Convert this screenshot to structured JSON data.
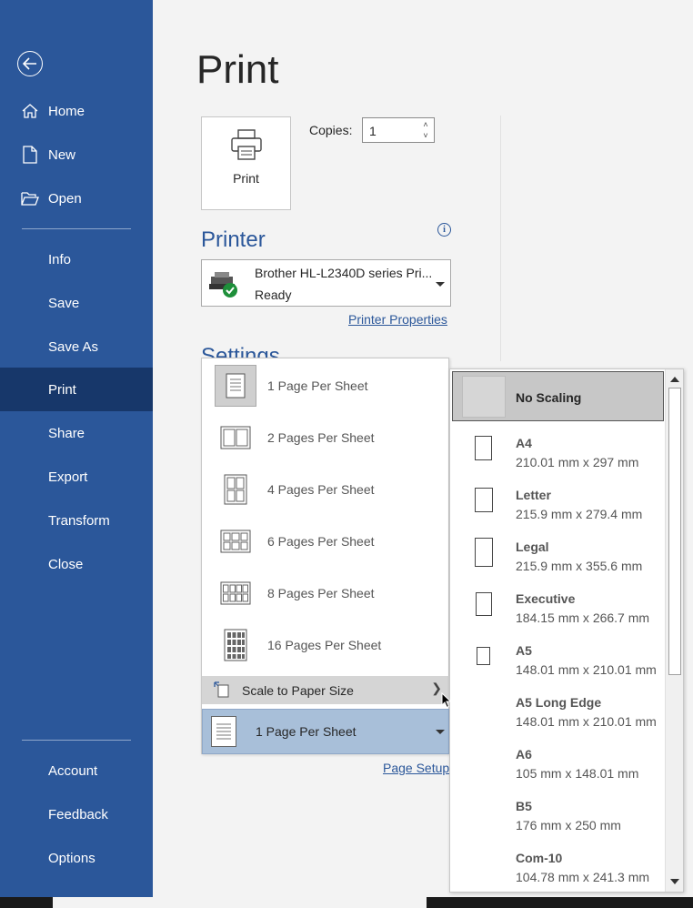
{
  "sidebar": {
    "items": [
      {
        "label": "Home",
        "icon": "home-icon"
      },
      {
        "label": "New",
        "icon": "new-document-icon"
      },
      {
        "label": "Open",
        "icon": "folder-open-icon"
      },
      {
        "label": "Info"
      },
      {
        "label": "Save"
      },
      {
        "label": "Save As"
      },
      {
        "label": "Print"
      },
      {
        "label": "Share"
      },
      {
        "label": "Export"
      },
      {
        "label": "Transform"
      },
      {
        "label": "Close"
      },
      {
        "label": "Account"
      },
      {
        "label": "Feedback"
      },
      {
        "label": "Options"
      }
    ],
    "active": "Print"
  },
  "main": {
    "title": "Print",
    "print_button_label": "Print",
    "copies_label": "Copies:",
    "copies_value": "1",
    "printer_heading": "Printer",
    "printer_name": "Brother HL-L2340D series Pri...",
    "printer_status": "Ready",
    "printer_properties_link": "Printer Properties",
    "settings_heading": "Settings",
    "page_setup_link": "Page Setup"
  },
  "pages_per_sheet_menu": {
    "items": [
      {
        "label": "1 Page Per Sheet",
        "selected": true
      },
      {
        "label": "2 Pages Per Sheet"
      },
      {
        "label": "4 Pages Per Sheet"
      },
      {
        "label": "6 Pages Per Sheet"
      },
      {
        "label": "8 Pages Per Sheet"
      },
      {
        "label": "16 Pages Per Sheet"
      }
    ],
    "scale_label": "Scale to Paper Size",
    "current_value": "1 Page Per Sheet"
  },
  "paper_size_menu": {
    "no_scaling_label": "No Scaling",
    "items": [
      {
        "name": "A4",
        "dim": "210.01 mm x 297 mm"
      },
      {
        "name": "Letter",
        "dim": "215.9 mm x 279.4 mm"
      },
      {
        "name": "Legal",
        "dim": "215.9 mm x 355.6 mm"
      },
      {
        "name": "Executive",
        "dim": "184.15 mm x 266.7 mm"
      },
      {
        "name": "A5",
        "dim": "148.01 mm x 210.01 mm"
      },
      {
        "name": "A5 Long Edge",
        "dim": "148.01 mm x 210.01 mm"
      },
      {
        "name": "A6",
        "dim": "105 mm x 148.01 mm"
      },
      {
        "name": "B5",
        "dim": "176 mm x 250 mm"
      },
      {
        "name": "Com-10",
        "dim": "104.78 mm x 241.3 mm"
      }
    ]
  },
  "colors": {
    "sidebar_bg": "#2b579a",
    "sidebar_active": "#17376a",
    "accent": "#2b579a",
    "ready_check": "#1e8f3a"
  }
}
